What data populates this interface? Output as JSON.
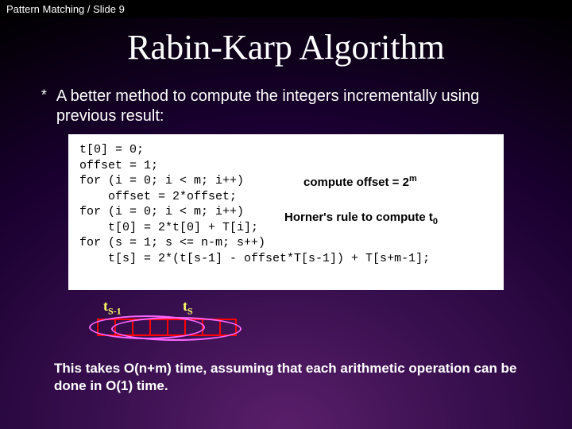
{
  "header": {
    "text": "Pattern Matching / Slide 9"
  },
  "title": "Rabin-Karp Algorithm",
  "bullet": {
    "icon": "*",
    "text": "A better method to compute the integers incrementally using previous result:"
  },
  "code": {
    "lines": [
      "t[0] = 0;",
      "offset = 1;",
      "for (i = 0; i < m; i++)",
      "    offset = 2*offset;",
      "for (i = 0; i < m; i++)",
      "    t[0] = 2*t[0] + T[i];",
      "for (s = 1; s <= n-m; s++)",
      "    t[s] = 2*(t[s-1] - offset*T[s-1]) + T[s+m-1];"
    ],
    "annot_offset_pre": "compute offset = 2",
    "annot_offset_sup": "m",
    "annot_horner_pre": "Horner's rule to compute t",
    "annot_horner_sub": "0"
  },
  "diagram": {
    "label_left_pre": "t",
    "label_left_sub": "S-1",
    "label_right_pre": "t",
    "label_right_sub": "S"
  },
  "conclusion": "This takes O(n+m) time, assuming that each arithmetic operation can be done in O(1) time."
}
